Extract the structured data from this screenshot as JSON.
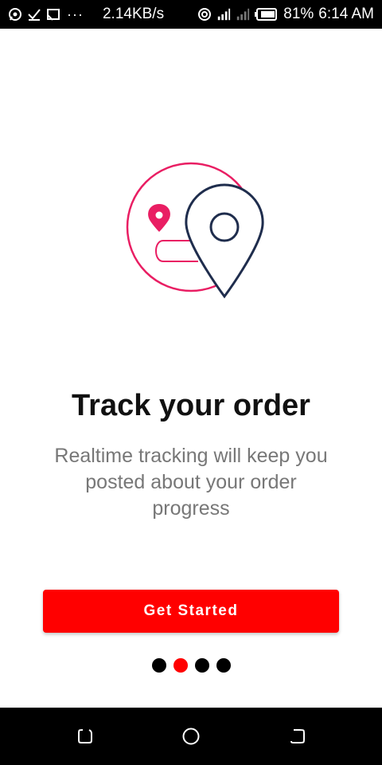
{
  "status_bar": {
    "left_icons": [
      "whatsapp-icon",
      "check-icon",
      "cast-icon"
    ],
    "overflow": "···",
    "net_speed": "2.14KB/s",
    "battery": "81%",
    "time": "6:14 AM"
  },
  "onboarding": {
    "title": "Track your order",
    "description": "Realtime tracking will keep you posted about your order progress",
    "cta_label": "Get Started",
    "pages_total": 4,
    "active_page_index": 1
  },
  "colors": {
    "accent": "#ff0000",
    "pin_pink": "#e91e63",
    "pin_navy": "#1f2d4d"
  },
  "nav_bar": {
    "buttons": [
      "recent-apps-icon",
      "home-icon",
      "back-icon"
    ]
  }
}
